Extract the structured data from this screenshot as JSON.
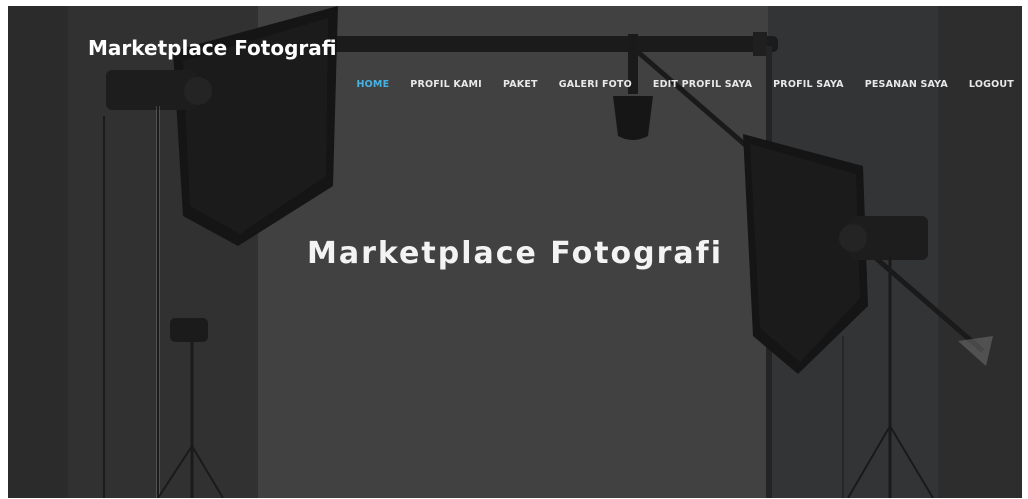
{
  "site": {
    "brand": "Marketplace Fotografi"
  },
  "nav": {
    "items": [
      {
        "label": "HOME",
        "active": true
      },
      {
        "label": "PROFIL KAMI",
        "active": false
      },
      {
        "label": "PAKET",
        "active": false
      },
      {
        "label": "GALERI FOTO",
        "active": false
      },
      {
        "label": "EDIT PROFIL SAYA",
        "active": false
      },
      {
        "label": "PROFIL SAYA",
        "active": false
      },
      {
        "label": "PESANAN SAYA",
        "active": false
      },
      {
        "label": "LOGOUT",
        "active": false
      }
    ]
  },
  "hero": {
    "title": "Marketplace Fotografi"
  },
  "colors": {
    "accent": "#47b2e4",
    "background": "#3b3b3c",
    "text": "#ffffff"
  }
}
